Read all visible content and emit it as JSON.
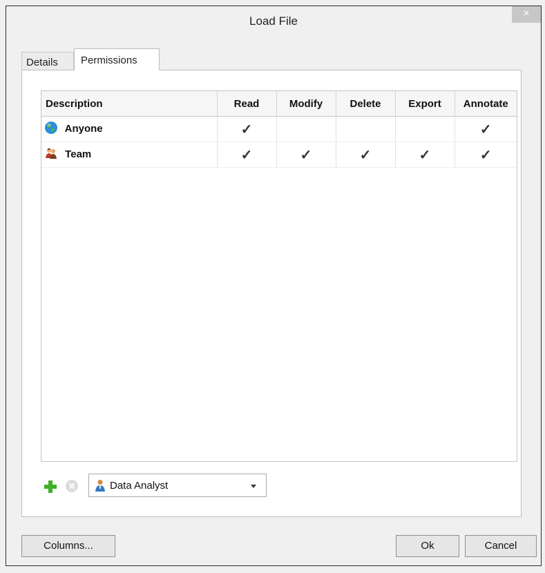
{
  "window": {
    "title": "Load File",
    "close_label": "×"
  },
  "tabs": [
    {
      "label": "Details",
      "active": false
    },
    {
      "label": "Permissions",
      "active": true
    }
  ],
  "table": {
    "columns": [
      "Description",
      "Read",
      "Modify",
      "Delete",
      "Export",
      "Annotate"
    ],
    "rows": [
      {
        "name": "Anyone",
        "icon": "globe-icon",
        "read": true,
        "modify": false,
        "delete": false,
        "export": false,
        "annotate": true
      },
      {
        "name": "Team",
        "icon": "team-icon",
        "read": true,
        "modify": true,
        "delete": true,
        "export": true,
        "annotate": true
      }
    ],
    "check_glyph": "✓"
  },
  "toolbar": {
    "add_icon": "plus-icon",
    "remove_icon": "remove-icon",
    "principal_select": {
      "value": "Data Analyst",
      "icon": "user-icon"
    }
  },
  "buttons": {
    "columns": "Columns...",
    "ok": "Ok",
    "cancel": "Cancel"
  },
  "colors": {
    "add": "#3fae29",
    "remove": "#d9d9d9",
    "globe": "#2a8fd8",
    "window_bg": "#f0f0f0"
  }
}
